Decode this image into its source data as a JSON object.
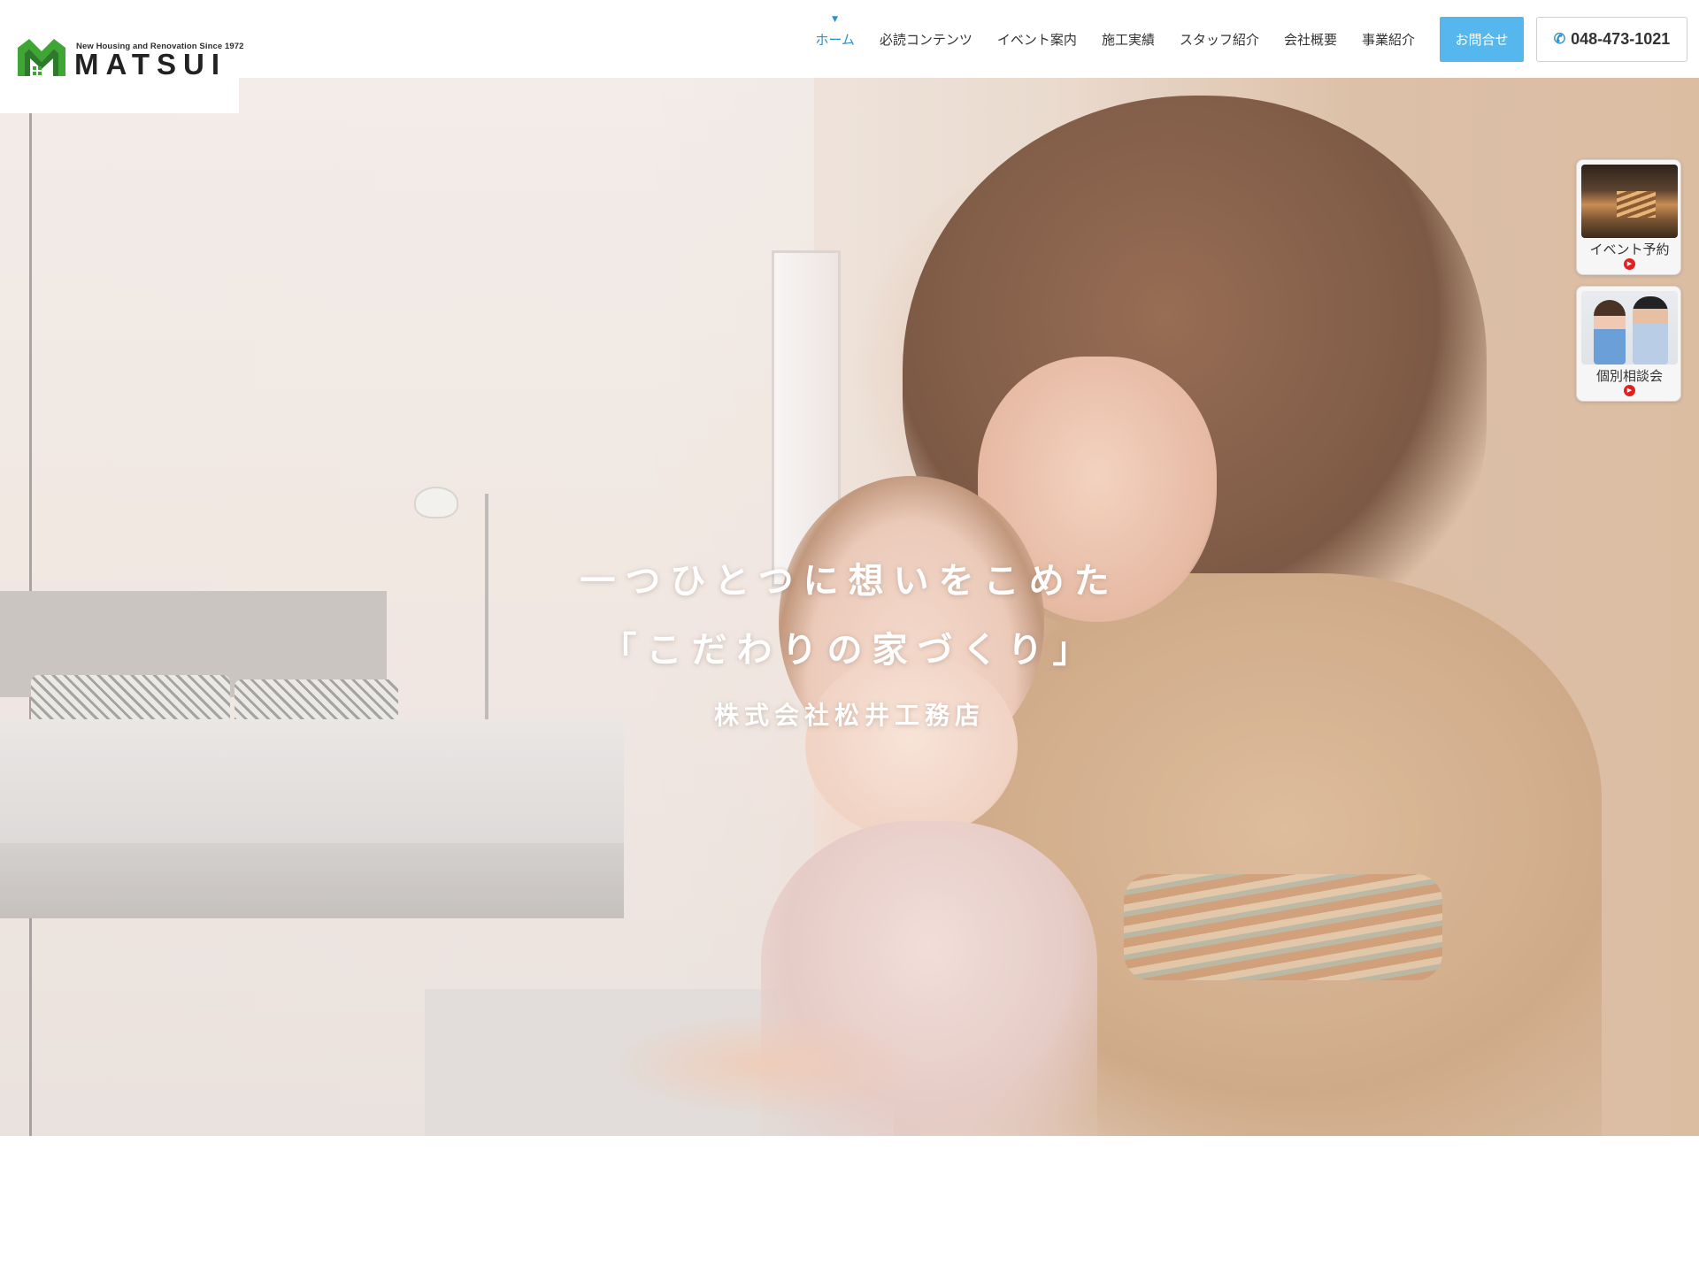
{
  "brand": {
    "tagline": "New Housing and Renovation Since 1972",
    "name": "MATSUI",
    "colors": {
      "green": "#3fa535",
      "accent_blue": "#2d8fd0",
      "button_blue": "#55b7ee"
    }
  },
  "nav": {
    "items": [
      {
        "label": "ホーム",
        "active": true
      },
      {
        "label": "必読コンテンツ"
      },
      {
        "label": "イベント案内"
      },
      {
        "label": "施工実績"
      },
      {
        "label": "スタッフ紹介"
      },
      {
        "label": "会社概要"
      },
      {
        "label": "事業紹介"
      }
    ],
    "contact_label": "お問合せ",
    "phone": "048-473-1021",
    "phone_icon": "phone-icon"
  },
  "hero": {
    "line1": "一つひとつに想いをこめた",
    "line2": "「こだわりの家づくり」",
    "line3": "株式会社松井工務店"
  },
  "side": {
    "event_label": "イベント予約",
    "consult_label": "個別相談会",
    "play_icon": "play-icon"
  }
}
